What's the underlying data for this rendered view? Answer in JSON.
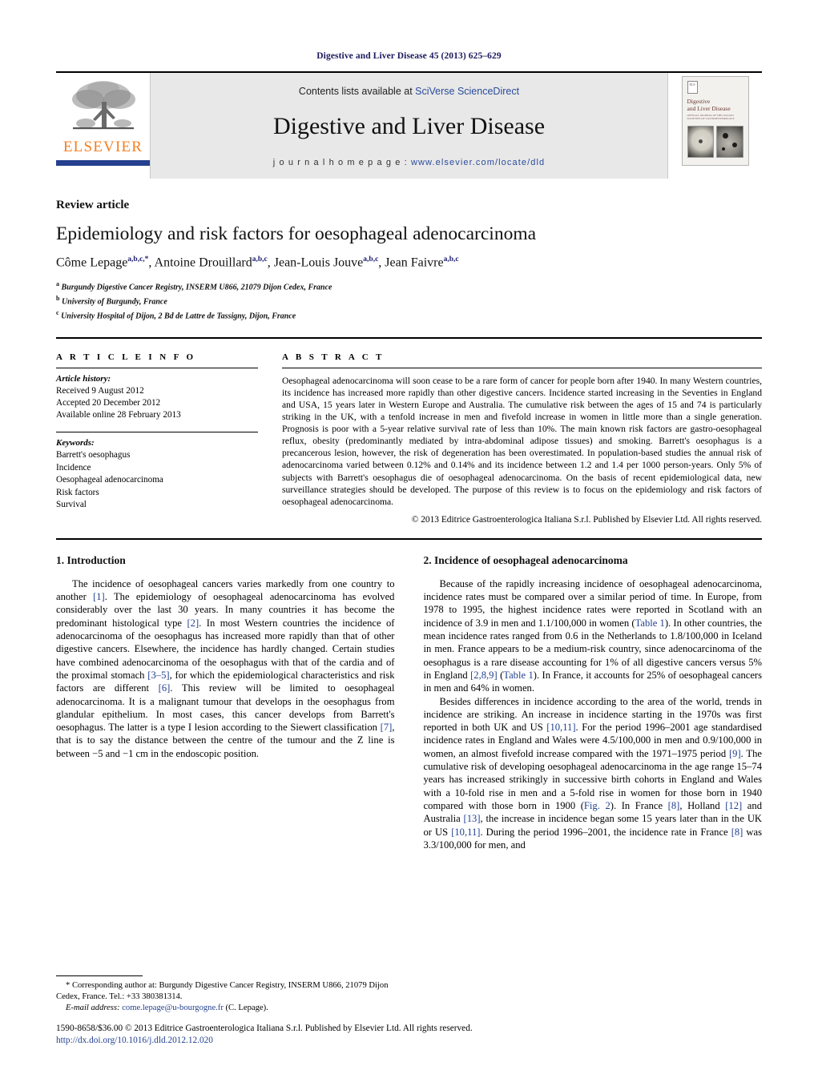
{
  "running_head": "Digestive and Liver Disease 45 (2013) 625–629",
  "masthead": {
    "publisher_logo_text": "ELSEVIER",
    "contents_prefix": "Contents lists available at ",
    "contents_link": "SciVerse ScienceDirect",
    "journal_title": "Digestive and Liver Disease",
    "homepage_prefix": "j o u r n a l   h o m e p a g e :  ",
    "homepage_url": "www.elsevier.com/locate/dld",
    "cover": {
      "logo_label": "ELS",
      "title_line1": "Digestive",
      "title_line2": "and Liver Disease",
      "subtitle": "OFFICIAL JOURNAL OF THE ITALIAN SOCIETIES OF GASTROENTEROLOGY"
    }
  },
  "article": {
    "kicker": "Review article",
    "title": "Epidemiology and risk factors for oesophageal adenocarcinoma",
    "authors": [
      {
        "name": "Côme Lepage",
        "sup": "a,b,c,*",
        "sep": ", "
      },
      {
        "name": "Antoine Drouillard",
        "sup": "a,b,c",
        "sep": ", "
      },
      {
        "name": "Jean-Louis Jouve",
        "sup": "a,b,c",
        "sep": ", "
      },
      {
        "name": "Jean Faivre",
        "sup": "a,b,c",
        "sep": ""
      }
    ],
    "affiliations": [
      {
        "marker": "a",
        "text": "Burgundy Digestive Cancer Registry, INSERM U866, 21079 Dijon Cedex, France"
      },
      {
        "marker": "b",
        "text": "University of Burgundy, France"
      },
      {
        "marker": "c",
        "text": "University Hospital of Dijon, 2 Bd de Lattre de Tassigny, Dijon, France"
      }
    ]
  },
  "article_info": {
    "heading": "A R T I C L E   I N F O",
    "history_label": "Article history:",
    "history": [
      "Received 9 August 2012",
      "Accepted 20 December 2012",
      "Available online 28 February 2013"
    ],
    "keywords_label": "Keywords:",
    "keywords": [
      "Barrett's oesophagus",
      "Incidence",
      "Oesophageal adenocarcinoma",
      "Risk factors",
      "Survival"
    ]
  },
  "abstract": {
    "heading": "A B S T R A C T",
    "body": "Oesophageal adenocarcinoma will soon cease to be a rare form of cancer for people born after 1940. In many Western countries, its incidence has increased more rapidly than other digestive cancers. Incidence started increasing in the Seventies in England and USA, 15 years later in Western Europe and Australia. The cumulative risk between the ages of 15 and 74 is particularly striking in the UK, with a tenfold increase in men and fivefold increase in women in little more than a single generation. Prognosis is poor with a 5-year relative survival rate of less than 10%. The main known risk factors are gastro-oesophageal reflux, obesity (predominantly mediated by intra-abdominal adipose tissues) and smoking. Barrett's oesophagus is a precancerous lesion, however, the risk of degeneration has been overestimated. In population-based studies the annual risk of adenocarcinoma varied between 0.12% and 0.14% and its incidence between 1.2 and 1.4 per 1000 person-years. Only 5% of subjects with Barrett's oesophagus die of oesophageal adenocarcinoma. On the basis of recent epidemiological data, new surveillance strategies should be developed. The purpose of this review is to focus on the epidemiology and risk factors of oesophageal adenocarcinoma.",
    "copyright": "© 2013 Editrice Gastroenterologica Italiana S.r.l. Published by Elsevier Ltd. All rights reserved."
  },
  "sections": {
    "left": {
      "heading": "1.  Introduction",
      "paragraph1_a": "The incidence of oesophageal cancers varies markedly from one country to another ",
      "ref1": "[1]",
      "paragraph1_b": ". The epidemiology of oesophageal adenocarcinoma has evolved considerably over the last 30 years. In many countries it has become the predominant histological type ",
      "ref2": "[2]",
      "paragraph1_c": ". In most Western countries the incidence of adenocarcinoma of the oesophagus has increased more rapidly than that of other digestive cancers. Elsewhere, the incidence has hardly changed. Certain studies have combined adenocarcinoma of the oesophagus with that of the cardia and of the proximal stomach ",
      "ref3": "[3–5]",
      "paragraph1_d": ", for which the epidemiological characteristics and risk factors are different ",
      "ref4": "[6]",
      "paragraph1_e": ". This review will be limited to oesophageal adenocarcinoma. It is a malignant tumour that develops in the oesophagus from glandular epithelium. In most cases, this cancer develops from Barrett's oesophagus. The latter is a type I lesion according to the Siewert classification ",
      "ref5": "[7]",
      "paragraph1_f": ", that is to say the distance between the centre of the tumour and the Z line is between −5 and −1 cm in the endoscopic position."
    },
    "right": {
      "heading": "2.  Incidence of oesophageal adenocarcinoma",
      "p1_a": "Because of the rapidly increasing incidence of oesophageal adenocarcinoma, incidence rates must be compared over a similar period of time. In Europe, from 1978 to 1995, the highest incidence rates were reported in Scotland with an incidence of 3.9 in men and 1.1/100,000 in women (",
      "p1_table1": "Table 1",
      "p1_b": "). In other countries, the mean incidence rates ranged from 0.6 in the Netherlands to 1.8/100,000 in Iceland in men. France appears to be a medium-risk country, since adenocarcinoma of the oesophagus is a rare disease accounting for 1% of all digestive cancers versus 5% in England ",
      "p1_ref289": "[2,8,9]",
      "p1_c": " (",
      "p1_table1b": "Table 1",
      "p1_d": "). In France, it accounts for 25% of oesophageal cancers in men and 64% in women.",
      "p2_a": "Besides differences in incidence according to the area of the world, trends in incidence are striking. An increase in incidence starting in the 1970s was first reported in both UK and US ",
      "p2_ref1011": "[10,11]",
      "p2_b": ". For the period 1996–2001 age standardised incidence rates in England and Wales were 4.5/100,000 in men and 0.9/100,000 in women, an almost fivefold increase compared with the 1971–1975 period ",
      "p2_ref9": "[9]",
      "p2_c": ". The cumulative risk of developing oesophageal adenocarcinoma in the age range 15–74 years has increased strikingly in successive birth cohorts in England and Wales with a 10-fold rise in men and a 5-fold rise in women for those born in 1940 compared with those born in 1900 (",
      "p2_fig2": "Fig. 2",
      "p2_d": "). In France ",
      "p2_ref8": "[8]",
      "p2_e": ", Holland ",
      "p2_ref12": "[12]",
      "p2_f": " and Australia ",
      "p2_ref13": "[13]",
      "p2_g": ", the increase in incidence began some 15 years later than in the UK or US ",
      "p2_ref1011b": "[10,11]",
      "p2_h": ". During the period 1996–2001, the incidence rate in France ",
      "p2_ref8b": "[8]",
      "p2_i": " was 3.3/100,000 for men, and"
    }
  },
  "footnotes": {
    "corresponding_marker": "*",
    "corresponding_text": " Corresponding author at: Burgundy Digestive Cancer Registry, INSERM U866, 21079 Dijon Cedex, France. Tel.: +33 380381314.",
    "email_label": "E-mail address:",
    "email": "come.lepage@u-bourgogne.fr",
    "email_suffix": " (C. Lepage)."
  },
  "bottom": {
    "issn_copyright": "1590-8658/$36.00 © 2013 Editrice Gastroenterologica Italiana S.r.l. Published by Elsevier Ltd. All rights reserved.",
    "doi": "http://dx.doi.org/10.1016/j.dld.2012.12.020"
  },
  "colors": {
    "link": "#23418f",
    "running_head": "#1a1a5e",
    "elsevier_orange": "#F57E20",
    "elsevier_blue": "#24408E",
    "band_gray": "#e8e8e8"
  }
}
